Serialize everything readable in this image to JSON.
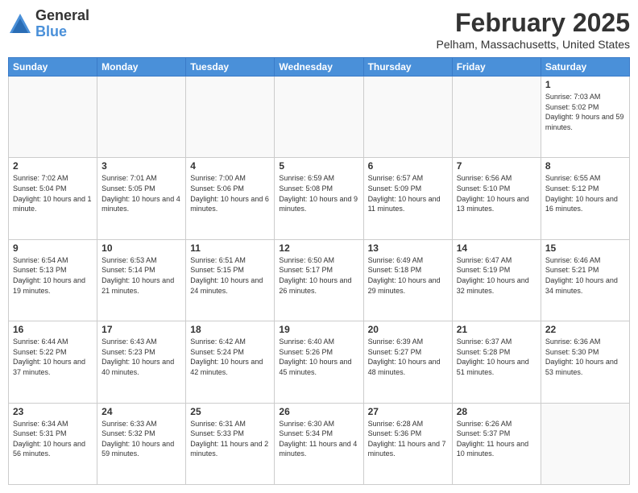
{
  "logo": {
    "general": "General",
    "blue": "Blue"
  },
  "header": {
    "title": "February 2025",
    "location": "Pelham, Massachusetts, United States"
  },
  "weekdays": [
    "Sunday",
    "Monday",
    "Tuesday",
    "Wednesday",
    "Thursday",
    "Friday",
    "Saturday"
  ],
  "weeks": [
    [
      {
        "day": "",
        "info": ""
      },
      {
        "day": "",
        "info": ""
      },
      {
        "day": "",
        "info": ""
      },
      {
        "day": "",
        "info": ""
      },
      {
        "day": "",
        "info": ""
      },
      {
        "day": "",
        "info": ""
      },
      {
        "day": "1",
        "info": "Sunrise: 7:03 AM\nSunset: 5:02 PM\nDaylight: 9 hours and 59 minutes."
      }
    ],
    [
      {
        "day": "2",
        "info": "Sunrise: 7:02 AM\nSunset: 5:04 PM\nDaylight: 10 hours and 1 minute."
      },
      {
        "day": "3",
        "info": "Sunrise: 7:01 AM\nSunset: 5:05 PM\nDaylight: 10 hours and 4 minutes."
      },
      {
        "day": "4",
        "info": "Sunrise: 7:00 AM\nSunset: 5:06 PM\nDaylight: 10 hours and 6 minutes."
      },
      {
        "day": "5",
        "info": "Sunrise: 6:59 AM\nSunset: 5:08 PM\nDaylight: 10 hours and 9 minutes."
      },
      {
        "day": "6",
        "info": "Sunrise: 6:57 AM\nSunset: 5:09 PM\nDaylight: 10 hours and 11 minutes."
      },
      {
        "day": "7",
        "info": "Sunrise: 6:56 AM\nSunset: 5:10 PM\nDaylight: 10 hours and 13 minutes."
      },
      {
        "day": "8",
        "info": "Sunrise: 6:55 AM\nSunset: 5:12 PM\nDaylight: 10 hours and 16 minutes."
      }
    ],
    [
      {
        "day": "9",
        "info": "Sunrise: 6:54 AM\nSunset: 5:13 PM\nDaylight: 10 hours and 19 minutes."
      },
      {
        "day": "10",
        "info": "Sunrise: 6:53 AM\nSunset: 5:14 PM\nDaylight: 10 hours and 21 minutes."
      },
      {
        "day": "11",
        "info": "Sunrise: 6:51 AM\nSunset: 5:15 PM\nDaylight: 10 hours and 24 minutes."
      },
      {
        "day": "12",
        "info": "Sunrise: 6:50 AM\nSunset: 5:17 PM\nDaylight: 10 hours and 26 minutes."
      },
      {
        "day": "13",
        "info": "Sunrise: 6:49 AM\nSunset: 5:18 PM\nDaylight: 10 hours and 29 minutes."
      },
      {
        "day": "14",
        "info": "Sunrise: 6:47 AM\nSunset: 5:19 PM\nDaylight: 10 hours and 32 minutes."
      },
      {
        "day": "15",
        "info": "Sunrise: 6:46 AM\nSunset: 5:21 PM\nDaylight: 10 hours and 34 minutes."
      }
    ],
    [
      {
        "day": "16",
        "info": "Sunrise: 6:44 AM\nSunset: 5:22 PM\nDaylight: 10 hours and 37 minutes."
      },
      {
        "day": "17",
        "info": "Sunrise: 6:43 AM\nSunset: 5:23 PM\nDaylight: 10 hours and 40 minutes."
      },
      {
        "day": "18",
        "info": "Sunrise: 6:42 AM\nSunset: 5:24 PM\nDaylight: 10 hours and 42 minutes."
      },
      {
        "day": "19",
        "info": "Sunrise: 6:40 AM\nSunset: 5:26 PM\nDaylight: 10 hours and 45 minutes."
      },
      {
        "day": "20",
        "info": "Sunrise: 6:39 AM\nSunset: 5:27 PM\nDaylight: 10 hours and 48 minutes."
      },
      {
        "day": "21",
        "info": "Sunrise: 6:37 AM\nSunset: 5:28 PM\nDaylight: 10 hours and 51 minutes."
      },
      {
        "day": "22",
        "info": "Sunrise: 6:36 AM\nSunset: 5:30 PM\nDaylight: 10 hours and 53 minutes."
      }
    ],
    [
      {
        "day": "23",
        "info": "Sunrise: 6:34 AM\nSunset: 5:31 PM\nDaylight: 10 hours and 56 minutes."
      },
      {
        "day": "24",
        "info": "Sunrise: 6:33 AM\nSunset: 5:32 PM\nDaylight: 10 hours and 59 minutes."
      },
      {
        "day": "25",
        "info": "Sunrise: 6:31 AM\nSunset: 5:33 PM\nDaylight: 11 hours and 2 minutes."
      },
      {
        "day": "26",
        "info": "Sunrise: 6:30 AM\nSunset: 5:34 PM\nDaylight: 11 hours and 4 minutes."
      },
      {
        "day": "27",
        "info": "Sunrise: 6:28 AM\nSunset: 5:36 PM\nDaylight: 11 hours and 7 minutes."
      },
      {
        "day": "28",
        "info": "Sunrise: 6:26 AM\nSunset: 5:37 PM\nDaylight: 11 hours and 10 minutes."
      },
      {
        "day": "",
        "info": ""
      }
    ]
  ]
}
